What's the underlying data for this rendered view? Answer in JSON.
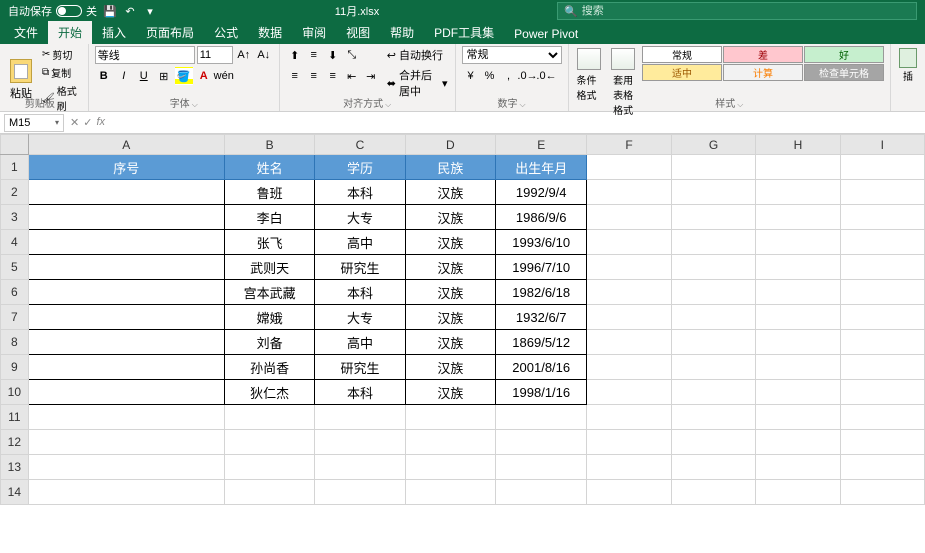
{
  "titlebar": {
    "autosave_label": "自动保存",
    "autosave_state": "关",
    "filename": "11月.xlsx",
    "search_placeholder": "搜索"
  },
  "tabs": {
    "file": "文件",
    "home": "开始",
    "insert": "插入",
    "page_layout": "页面布局",
    "formulas": "公式",
    "data": "数据",
    "review": "审阅",
    "view": "视图",
    "help": "帮助",
    "pdf": "PDF工具集",
    "powerpivot": "Power Pivot"
  },
  "ribbon": {
    "clipboard": {
      "label": "剪贴板",
      "paste": "粘贴",
      "cut": "剪切",
      "copy": "复制",
      "format_painter": "格式刷"
    },
    "font": {
      "label": "字体",
      "name": "等线",
      "size": "11"
    },
    "alignment": {
      "label": "对齐方式",
      "wrap": "自动换行",
      "merge": "合并后居中"
    },
    "number": {
      "label": "数字",
      "format": "常规"
    },
    "styles": {
      "label": "样式",
      "conditional": "条件格式",
      "format_table": "套用\n表格格式",
      "normal": "常规",
      "bad": "差",
      "good": "好",
      "neutral": "适中",
      "calc": "计算",
      "check": "检查单元格"
    },
    "insert": "插"
  },
  "formula_bar": {
    "name_box": "M15",
    "fx": "fx"
  },
  "sheet": {
    "columns": [
      "A",
      "B",
      "C",
      "D",
      "E",
      "F",
      "G",
      "H",
      "I"
    ],
    "headers": {
      "A": "序号",
      "B": "姓名",
      "C": "学历",
      "D": "民族",
      "E": "出生年月"
    },
    "rows": [
      {
        "B": "鲁班",
        "C": "本科",
        "D": "汉族",
        "E": "1992/9/4"
      },
      {
        "B": "李白",
        "C": "大专",
        "D": "汉族",
        "E": "1986/9/6"
      },
      {
        "B": "张飞",
        "C": "高中",
        "D": "汉族",
        "E": "1993/6/10"
      },
      {
        "B": "武则天",
        "C": "研究生",
        "D": "汉族",
        "E": "1996/7/10"
      },
      {
        "B": "宫本武藏",
        "C": "本科",
        "D": "汉族",
        "E": "1982/6/18"
      },
      {
        "B": "嫦娥",
        "C": "大专",
        "D": "汉族",
        "E": "1932/6/7"
      },
      {
        "B": "刘备",
        "C": "高中",
        "D": "汉族",
        "E": "1869/5/12"
      },
      {
        "B": "孙尚香",
        "C": "研究生",
        "D": "汉族",
        "E": "2001/8/16"
      },
      {
        "B": "狄仁杰",
        "C": "本科",
        "D": "汉族",
        "E": "1998/1/16"
      }
    ],
    "visible_rows": 14
  }
}
